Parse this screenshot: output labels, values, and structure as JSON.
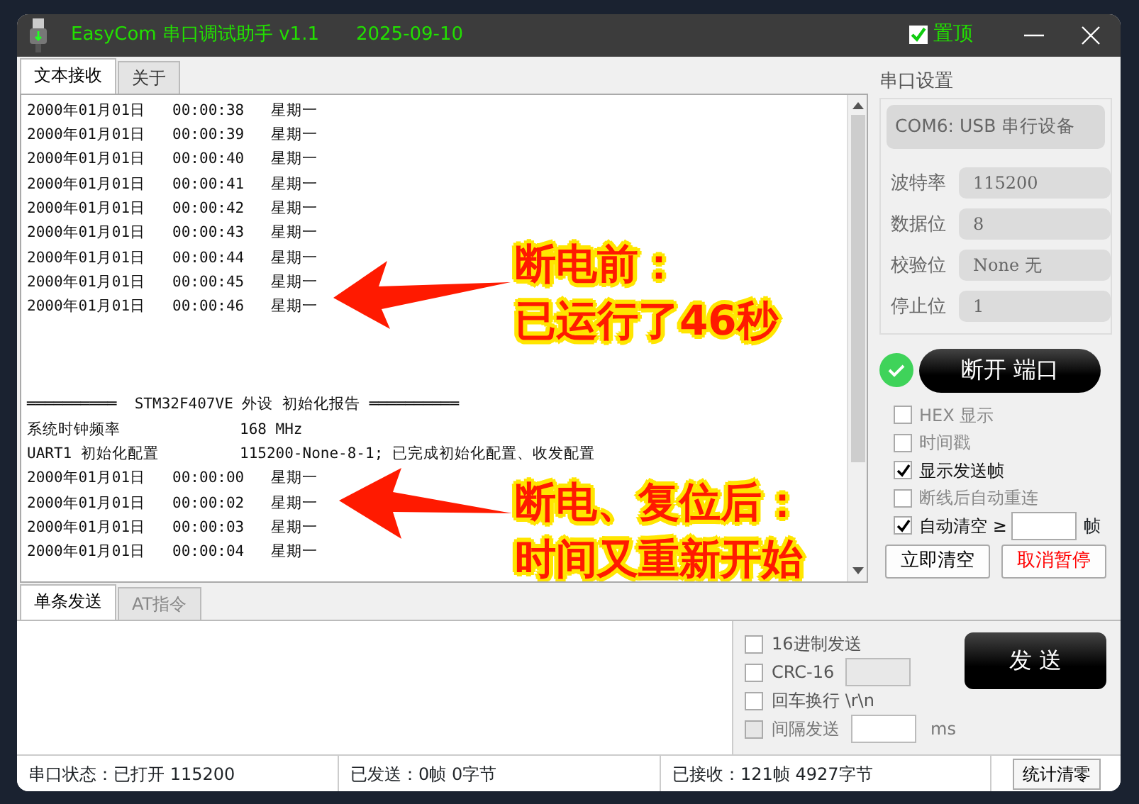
{
  "window": {
    "title": "EasyCom 串口调试助手 v1.1",
    "date": "2025-09-10",
    "pin": {
      "label": "置顶",
      "checked": true
    }
  },
  "receive_tabs": [
    {
      "label": "文本接收",
      "selected": true
    },
    {
      "label": "关于",
      "selected": false
    }
  ],
  "log": {
    "blocks": [
      {
        "lines": [
          {
            "kind": "text",
            "text": "2000年01月01日   00:00:38   星期一"
          },
          {
            "kind": "text",
            "text": "2000年01月01日   00:00:39   星期一"
          },
          {
            "kind": "text",
            "text": "2000年01月01日   00:00:40   星期一"
          },
          {
            "kind": "text",
            "text": "2000年01月01日   00:00:41   星期一"
          },
          {
            "kind": "text",
            "text": "2000年01月01日   00:00:42   星期一"
          },
          {
            "kind": "text",
            "text": "2000年01月01日   00:00:43   星期一"
          },
          {
            "kind": "text",
            "text": "2000年01月01日   00:00:44   星期一"
          },
          {
            "kind": "text",
            "text": "2000年01月01日   00:00:45   星期一"
          },
          {
            "kind": "text",
            "text": "2000年01月01日   00:00:46   星期一"
          }
        ]
      },
      {
        "lines": [
          {
            "kind": "text",
            "text": "══════════  STM32F407VE 外设 初始化报告 ══════════"
          },
          {
            "kind": "pair",
            "cols": [
              "系统时钟频率",
              "168 MHz"
            ]
          },
          {
            "kind": "pair",
            "cols": [
              "UART1 初始化配置",
              "115200-None-8-1; 已完成初始化配置、收发配置"
            ]
          },
          {
            "kind": "text",
            "text": "2000年01月01日   00:00:00   星期一"
          },
          {
            "kind": "text",
            "text": "2000年01月01日   00:00:02   星期一"
          },
          {
            "kind": "text",
            "text": "2000年01月01日   00:00:03   星期一"
          },
          {
            "kind": "text",
            "text": "2000年01月01日   00:00:04   星期一"
          }
        ]
      }
    ]
  },
  "annotations": [
    {
      "lines": [
        "断电前：",
        "已运行了46秒"
      ]
    },
    {
      "lines": [
        "断电、复位后：",
        "时间又重新开始"
      ]
    }
  ],
  "port_settings": {
    "title": "串口设置",
    "port": "COM6: USB 串行设备",
    "fields": [
      {
        "label": "波特率",
        "value": "115200"
      },
      {
        "label": "数据位",
        "value": "8"
      },
      {
        "label": "校验位",
        "value": "None  无"
      },
      {
        "label": "停止位",
        "value": "1"
      }
    ]
  },
  "connect": {
    "connected": true,
    "label": "断开 端口"
  },
  "options": [
    {
      "kind": "plain",
      "label": "HEX 显示",
      "checked": false
    },
    {
      "kind": "plain",
      "label": "时间戳",
      "checked": false
    },
    {
      "kind": "plain",
      "label": "显示发送帧",
      "checked": true
    },
    {
      "kind": "plain",
      "label": "断线后自动重连",
      "checked": false
    },
    {
      "kind": "threshold",
      "label": "自动清空 ≥",
      "checked": true,
      "unit": "帧"
    }
  ],
  "actions": [
    {
      "kind": "normal",
      "label": "立即清空"
    },
    {
      "kind": "warning",
      "label": "取消暂停"
    }
  ],
  "send_tabs": [
    {
      "label": "单条发送",
      "selected": true
    },
    {
      "label": "AT指令",
      "selected": false
    }
  ],
  "send_options": [
    {
      "kind": "plain",
      "label": "16进制发送",
      "checked": false,
      "disabled": false
    },
    {
      "kind": "field",
      "label": "CRC-16",
      "checked": false,
      "disabled": false,
      "field_disabled": true
    },
    {
      "kind": "plain",
      "label": "回车换行 \\r\\n",
      "checked": false,
      "disabled": false
    },
    {
      "kind": "field",
      "label": "间隔发送",
      "checked": false,
      "disabled": true,
      "field_disabled": false,
      "unit": "ms"
    }
  ],
  "send_button": "发 送",
  "status_bar": [
    "串口状态：已打开 115200",
    "已发送：0帧   0字节",
    "已接收：121帧   4927字节"
  ],
  "reset_button": "统计清零"
}
